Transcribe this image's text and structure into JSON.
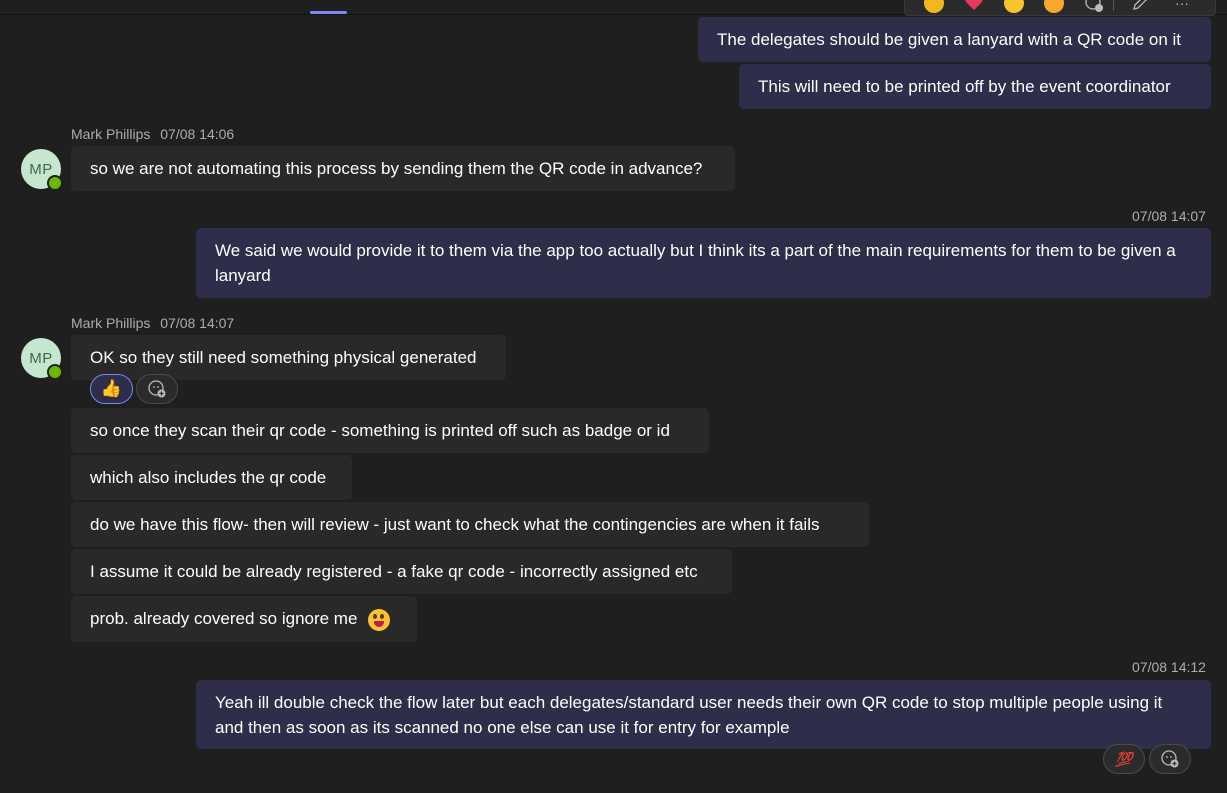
{
  "colors": {
    "background": "#1f1f1f",
    "outgoing_bubble": "#2f2e4a",
    "incoming_bubble": "#292929",
    "accent": "#7f85f5",
    "presence_available": "#6bb700"
  },
  "reaction_bar": {
    "icons": [
      "like-icon",
      "heart-icon",
      "laugh-icon",
      "surprised-icon",
      "add-reaction-icon",
      "edit-icon",
      "more-options-icon"
    ],
    "more_label": "···"
  },
  "messages": {
    "out1": "The delegates should be given a lanyard with a QR code on it",
    "out2": "This will need to be printed off by the event coordinator",
    "group1": {
      "sender": "Mark Phillips",
      "timestamp": "07/08 14:06",
      "initials": "MP",
      "text": "so we are not automating this process by sending them the QR code in advance?"
    },
    "out3": {
      "timestamp": "07/08 14:07",
      "text": "We said we would provide it to them via the app too actually but I think its a part of the main requirements for them to be given a lanyard"
    },
    "group2": {
      "sender": "Mark Phillips",
      "timestamp": "07/08 14:07",
      "initials": "MP",
      "m1": "OK so they still need something physical generated",
      "m1_reaction": "👍",
      "m2": "so once they scan their qr code - something is printed off such as badge or id",
      "m3": "which also includes the qr code",
      "m4": "do we have this flow- then will review - just want to check what the contingencies are when it fails",
      "m5": "I assume it could be already registered - a fake qr code - incorrectly assigned etc",
      "m6": "prob. already covered so ignore me"
    },
    "out4": {
      "timestamp": "07/08 14:12",
      "text": "Yeah ill double check the flow later but each delegates/standard user needs their own QR code to stop multiple people using it and then as soon as its scanned no one else can use it for entry for example",
      "reaction": "💯"
    }
  }
}
